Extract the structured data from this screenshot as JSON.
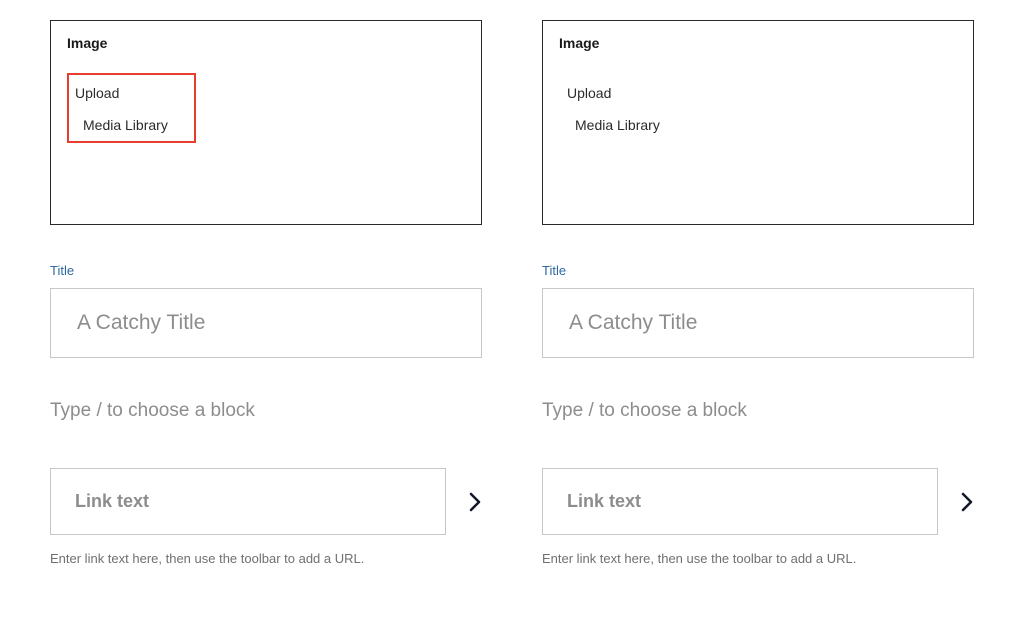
{
  "columns": [
    {
      "highlighted": true,
      "image_heading": "Image",
      "upload_label": "Upload",
      "media_label": "Media Library",
      "title_label": "Title",
      "title_placeholder": "A Catchy Title",
      "title_value": "",
      "block_prompt": "Type / to choose a block",
      "link_placeholder": "Link text",
      "link_value": "",
      "help_text": "Enter link text here, then use the toolbar to add a URL."
    },
    {
      "highlighted": false,
      "image_heading": "Image",
      "upload_label": "Upload",
      "media_label": "Media Library",
      "title_label": "Title",
      "title_placeholder": "A Catchy Title",
      "title_value": "",
      "block_prompt": "Type / to choose a block",
      "link_placeholder": "Link text",
      "link_value": "",
      "help_text": "Enter link text here, then use the toolbar to add a URL."
    }
  ]
}
